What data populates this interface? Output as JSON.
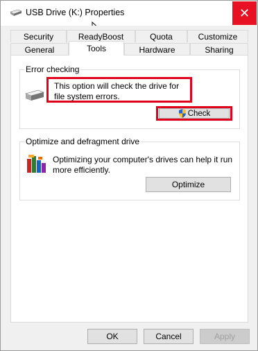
{
  "window": {
    "title": "USB Drive (K:) Properties",
    "close_glyph": "✕",
    "accent_close": "#e81123"
  },
  "tabs": {
    "row1": [
      "Security",
      "ReadyBoost",
      "Quota",
      "Customize"
    ],
    "row2": [
      "General",
      "Tools",
      "Hardware",
      "Sharing"
    ],
    "active": "Tools"
  },
  "error_checking": {
    "label": "Error checking",
    "description": "This option will check the drive for file system errors.",
    "check_button": "Check",
    "icon": "drive-icon",
    "button_icon": "shield-icon"
  },
  "optimize": {
    "label": "Optimize and defragment drive",
    "description": "Optimizing your computer's drives can help it run more efficiently.",
    "optimize_button": "Optimize",
    "icon": "defrag-icon"
  },
  "footer": {
    "ok": "OK",
    "cancel": "Cancel",
    "apply": "Apply"
  },
  "colors": {
    "highlight": "#e0001b"
  }
}
